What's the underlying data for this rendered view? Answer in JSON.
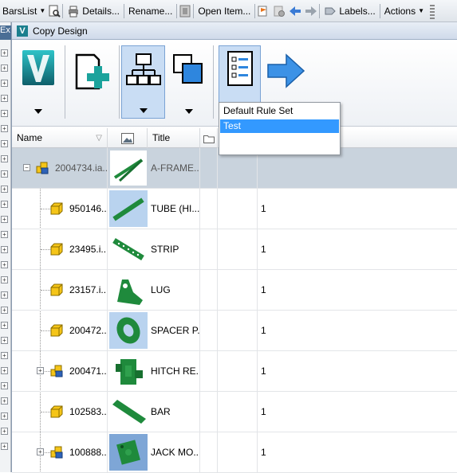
{
  "toolbar": {
    "barslist": "BarsList",
    "details": "Details...",
    "rename": "Rename...",
    "open_item": "Open Item...",
    "labels": "Labels...",
    "actions": "Actions"
  },
  "leftstrip": {
    "label": "Ex"
  },
  "dialog": {
    "title": "Copy Design",
    "logo_letter": "V"
  },
  "dropdown": {
    "items": [
      "Default Rule Set",
      "Test"
    ],
    "selected": "Test"
  },
  "grid": {
    "headers": {
      "name": "Name",
      "title": "Title"
    },
    "rows": [
      {
        "name": "2004734.ia...",
        "title": "A-FRAME...",
        "qty": "",
        "expandable": true,
        "type": "assembly"
      },
      {
        "name": "950146...",
        "title": "TUBE (HI...",
        "qty": "1",
        "expandable": false,
        "type": "part"
      },
      {
        "name": "23495.i...",
        "title": "STRIP",
        "qty": "1",
        "expandable": false,
        "type": "part"
      },
      {
        "name": "23157.i...",
        "title": "LUG",
        "qty": "1",
        "expandable": false,
        "type": "part"
      },
      {
        "name": "200472...",
        "title": "SPACER P...",
        "qty": "1",
        "expandable": false,
        "type": "part"
      },
      {
        "name": "200471...",
        "title": "HITCH RE...",
        "qty": "1",
        "expandable": true,
        "type": "assembly"
      },
      {
        "name": "102583...",
        "title": "BAR",
        "qty": "1",
        "expandable": false,
        "type": "part"
      },
      {
        "name": "100888...",
        "title": "JACK MO...",
        "qty": "1",
        "expandable": true,
        "type": "assembly"
      }
    ]
  },
  "colors": {
    "accent": "#3399ff",
    "part_green": "#1f8a3c",
    "part_yellow": "#f5c518"
  }
}
